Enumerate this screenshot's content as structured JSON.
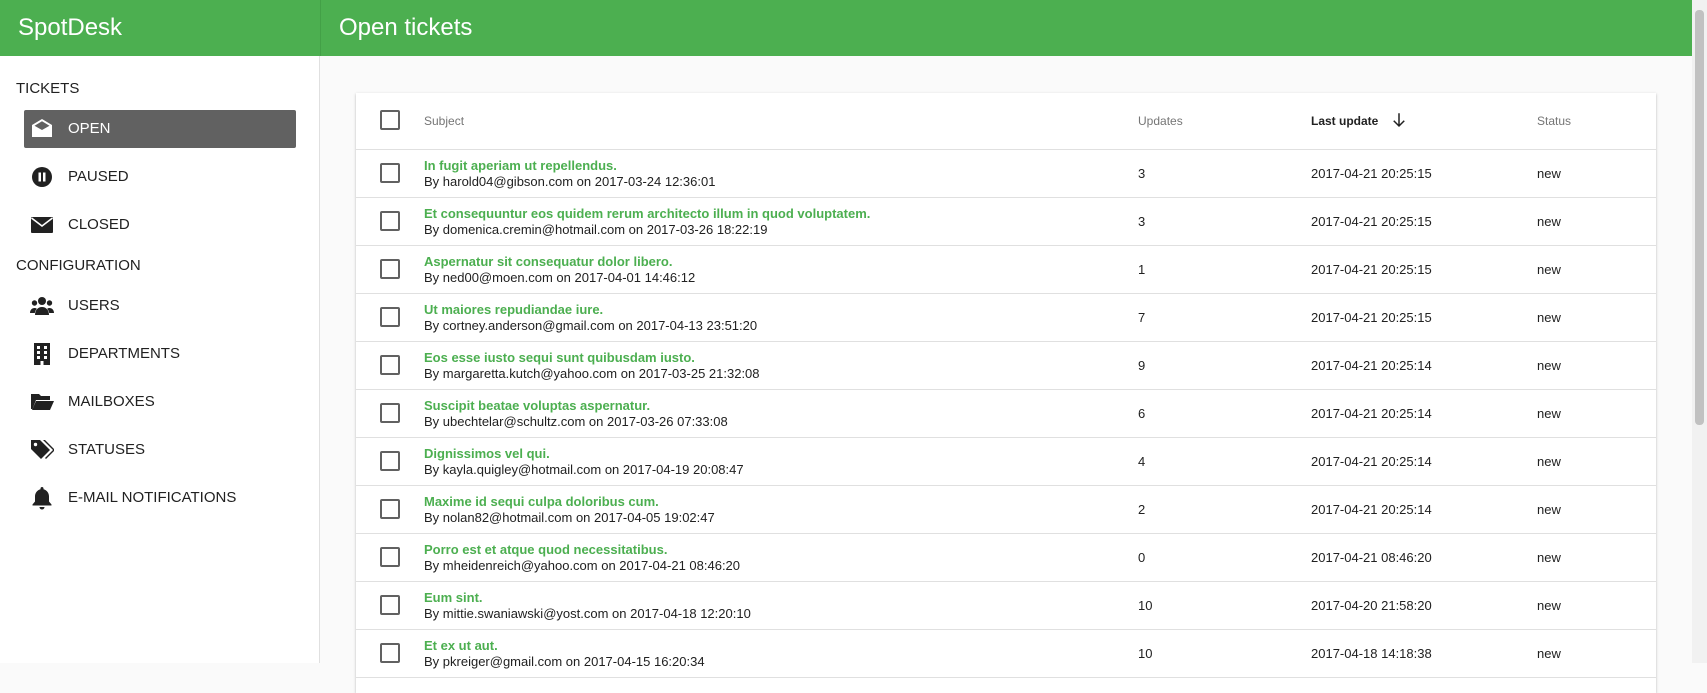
{
  "app": {
    "brand": "SpotDesk",
    "page_title": "Open tickets"
  },
  "sidebar": {
    "sections": [
      {
        "title": "TICKETS",
        "items": [
          {
            "label": "OPEN",
            "icon": "envelope-open-icon",
            "active": true
          },
          {
            "label": "PAUSED",
            "icon": "pause-circle-icon",
            "active": false
          },
          {
            "label": "CLOSED",
            "icon": "envelope-icon",
            "active": false
          }
        ]
      },
      {
        "title": "CONFIGURATION",
        "items": [
          {
            "label": "USERS",
            "icon": "users-icon",
            "active": false
          },
          {
            "label": "DEPARTMENTS",
            "icon": "building-icon",
            "active": false
          },
          {
            "label": "MAILBOXES",
            "icon": "folder-open-icon",
            "active": false
          },
          {
            "label": "STATUSES",
            "icon": "tags-icon",
            "active": false
          },
          {
            "label": "E-MAIL NOTIFICATIONS",
            "icon": "bell-icon",
            "active": false
          }
        ]
      }
    ]
  },
  "table": {
    "headers": {
      "subject": "Subject",
      "updates": "Updates",
      "last_update": "Last update",
      "status": "Status"
    },
    "sort": {
      "column": "last_update",
      "direction": "desc",
      "icon": "arrow-down-icon"
    },
    "rows": [
      {
        "subject": "In fugit aperiam ut repellendus.",
        "byline": "By harold04@gibson.com on 2017-03-24 12:36:01",
        "updates": "3",
        "last_update": "2017-04-21 20:25:15",
        "status": "new"
      },
      {
        "subject": "Et consequuntur eos quidem rerum architecto illum in quod voluptatem.",
        "byline": "By domenica.cremin@hotmail.com on 2017-03-26 18:22:19",
        "updates": "3",
        "last_update": "2017-04-21 20:25:15",
        "status": "new"
      },
      {
        "subject": "Aspernatur sit consequatur dolor libero.",
        "byline": "By ned00@moen.com on 2017-04-01 14:46:12",
        "updates": "1",
        "last_update": "2017-04-21 20:25:15",
        "status": "new"
      },
      {
        "subject": "Ut maiores repudiandae iure.",
        "byline": "By cortney.anderson@gmail.com on 2017-04-13 23:51:20",
        "updates": "7",
        "last_update": "2017-04-21 20:25:15",
        "status": "new"
      },
      {
        "subject": "Eos esse iusto sequi sunt quibusdam iusto.",
        "byline": "By margaretta.kutch@yahoo.com on 2017-03-25 21:32:08",
        "updates": "9",
        "last_update": "2017-04-21 20:25:14",
        "status": "new"
      },
      {
        "subject": "Suscipit beatae voluptas aspernatur.",
        "byline": "By ubechtelar@schultz.com on 2017-03-26 07:33:08",
        "updates": "6",
        "last_update": "2017-04-21 20:25:14",
        "status": "new"
      },
      {
        "subject": "Dignissimos vel qui.",
        "byline": "By kayla.quigley@hotmail.com on 2017-04-19 20:08:47",
        "updates": "4",
        "last_update": "2017-04-21 20:25:14",
        "status": "new"
      },
      {
        "subject": "Maxime id sequi culpa doloribus cum.",
        "byline": "By nolan82@hotmail.com on 2017-04-05 19:02:47",
        "updates": "2",
        "last_update": "2017-04-21 20:25:14",
        "status": "new"
      },
      {
        "subject": "Porro est et atque quod necessitatibus.",
        "byline": "By mheidenreich@yahoo.com on 2017-04-21 08:46:20",
        "updates": "0",
        "last_update": "2017-04-21 08:46:20",
        "status": "new"
      },
      {
        "subject": "Eum sint.",
        "byline": "By mittie.swaniawski@yost.com on 2017-04-18 12:20:10",
        "updates": "10",
        "last_update": "2017-04-20 21:58:20",
        "status": "new"
      },
      {
        "subject": "Et ex ut aut.",
        "byline": "By pkreiger@gmail.com on 2017-04-15 16:20:34",
        "updates": "10",
        "last_update": "2017-04-18 14:18:38",
        "status": "new"
      }
    ]
  },
  "colors": {
    "primary": "#4caf50",
    "active_nav": "#616161",
    "link_green": "#4caf50"
  }
}
